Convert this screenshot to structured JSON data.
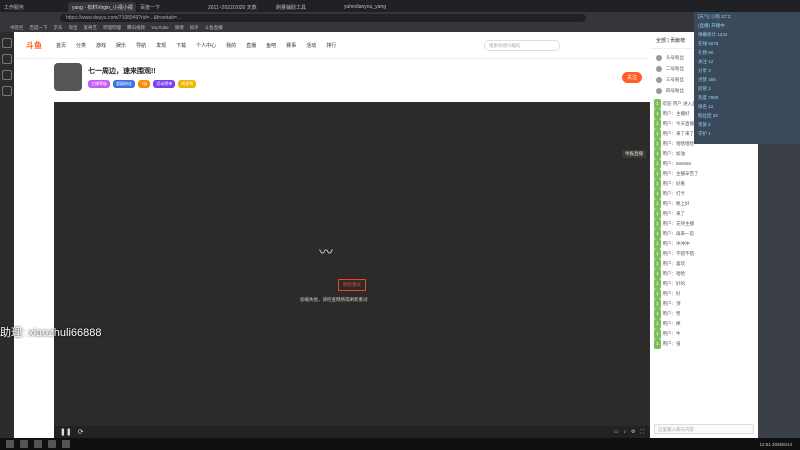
{
  "browser": {
    "tabs": [
      "工作服务",
      "yang - 有料Virgin_小视小视",
      "百度一下",
      "2011~2022/2026 天数",
      "刷量辅助工具",
      "yuhedianyou_yang"
    ],
    "url": "https://www.douyu.com/7108949?rid=...&fromtab=..."
  },
  "bookmarks": [
    "书签栏",
    "百度一下",
    "京东",
    "淘宝",
    "爱奇艺",
    "哔哩哔哩",
    "腾讯视频",
    "YouTube",
    "微博",
    "知乎",
    "斗鱼直播"
  ],
  "site": {
    "logo": "斗鱼",
    "nav": [
      "首页",
      "分类",
      "游戏",
      "娱乐",
      "导航",
      "发现",
      "下载",
      "个人中心",
      "我的",
      "直播",
      "鱼吧",
      "赛事",
      "活动",
      "排行"
    ],
    "search_placeholder": "搜索你感兴趣的"
  },
  "room": {
    "title": "七一周边，速来围观!!",
    "badges": [
      "主播等级",
      "超级粉丝",
      "7级",
      "活动榜单",
      "周星榜"
    ],
    "follow": "关注"
  },
  "player": {
    "error_button": "刷新重试",
    "error_text": "加载失败，请检查网络或刷新重试",
    "report": "举报直播",
    "loading_glyph": "〰"
  },
  "chat": {
    "header": "全部 | 贡献榜",
    "ranks": [
      "头号粉丝",
      "二号粉丝",
      "三号粉丝",
      "四号粉丝"
    ],
    "lines": [
      "欢迎 用户 进入直播间",
      "用户：主播好",
      "用户：今天直播几点结束",
      "用户：来了来了",
      "用户：哈哈哈哈",
      "用户：加油",
      "用户：666666",
      "用户：主播辛苦了",
      "用户：好看",
      "用户：打卡",
      "用户：晚上好",
      "用户：来了",
      "用户：支持主播",
      "用户：再来一首",
      "用户：冲冲冲",
      "用户：不错不错",
      "用户：喜欢",
      "用户：哈哈",
      "用户：好的",
      "用户：好",
      "用户：顶",
      "用户：赞",
      "用户：棒",
      "用户：牛",
      "用户：强"
    ],
    "input_placeholder": "这里输入聊天内容"
  },
  "overlay": {
    "lines": [
      "[天气] 小雨 22°C",
      "(直播) 开播中",
      "弹幕统计 1234",
      "在线 5678",
      "礼物 90",
      "关注 12",
      "分享 3",
      "点赞 456",
      "房管 2",
      "热度 7890",
      "排名 12",
      "粉丝团 34",
      "贵族 5",
      "守护 1"
    ]
  },
  "watermark": "助理: xiaozhuli66888",
  "taskbar": {
    "clock": "12:51 2026/6/14"
  }
}
